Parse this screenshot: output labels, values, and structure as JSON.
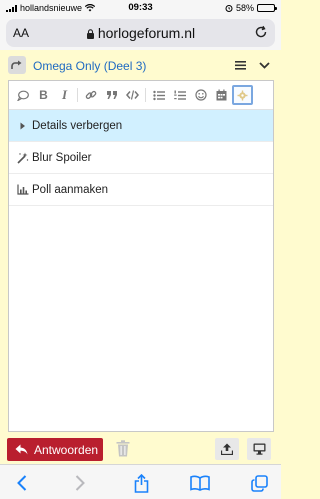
{
  "status_bar": {
    "carrier": "hollandsnieuwe",
    "time": "09:33",
    "battery": "58%",
    "battery_level": 0.58
  },
  "browser": {
    "text_size_label": "AA",
    "domain": "horlogeforum.nl",
    "icons": [
      "lock-icon",
      "reload-icon"
    ]
  },
  "composer": {
    "topic_title": "Omega Only (Deel 3)",
    "toolbar_icons": [
      "quote-bubble-icon",
      "bold-icon",
      "italic-icon",
      "link-icon",
      "blockquote-icon",
      "code-icon",
      "bullet-list-icon",
      "numbered-list-icon",
      "emoji-icon",
      "date-icon",
      "gear-icon"
    ],
    "bold_label": "B",
    "italic_label": "I",
    "menu_items": [
      {
        "label": "Details verbergen",
        "icon": "caret-right-icon"
      },
      {
        "label": "Blur Spoiler",
        "icon": "magic-icon"
      },
      {
        "label": "Poll aanmaken",
        "icon": "bar-chart-icon"
      }
    ],
    "reply_label": "Antwoorden"
  },
  "colors": {
    "composer_bg": "#fffbcf",
    "link_blue": "#1f6ac2",
    "reply_red": "#b91f2e",
    "selected_item": "#d1f0ff",
    "ios_blue": "#1a82fb"
  }
}
